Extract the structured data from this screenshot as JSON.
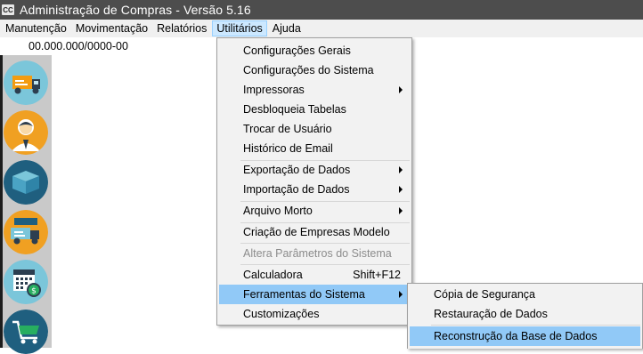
{
  "window": {
    "icon_text": "CC",
    "title": "Administração de Compras - Versão 5.16"
  },
  "menubar": {
    "items": [
      {
        "label": "Manutenção"
      },
      {
        "label": "Movimentação"
      },
      {
        "label": "Relatórios"
      },
      {
        "label": "Utilitários"
      },
      {
        "label": "Ajuda"
      }
    ]
  },
  "cnpj": "00.000.000/0000-00",
  "sidebar": {
    "buttons": [
      {
        "icon": "delivery-truck-icon",
        "color": "#7bc6da"
      },
      {
        "icon": "person-icon",
        "color": "#f0a022"
      },
      {
        "icon": "box-icon",
        "color": "#1f5f7f"
      },
      {
        "icon": "truck-transfer-icon",
        "color": "#f0a022"
      },
      {
        "icon": "calendar-money-icon",
        "color": "#7bc6da"
      },
      {
        "icon": "cart-icon",
        "color": "#1f5f7f"
      }
    ]
  },
  "utilitarios_menu": {
    "items": [
      {
        "label": "Configurações Gerais"
      },
      {
        "label": "Configurações do Sistema"
      },
      {
        "label": "Impressoras"
      },
      {
        "label": "Desbloqueia Tabelas"
      },
      {
        "label": "Trocar de Usuário"
      },
      {
        "label": "Histórico de Email"
      },
      {
        "label": "Exportação de Dados"
      },
      {
        "label": "Importação de Dados"
      },
      {
        "label": "Arquivo Morto"
      },
      {
        "label": "Criação de Empresas Modelo"
      },
      {
        "label": "Altera Parâmetros do Sistema"
      },
      {
        "label": "Calculadora",
        "shortcut": "Shift+F12"
      },
      {
        "label": "Ferramentas do Sistema"
      },
      {
        "label": "Customizações"
      }
    ]
  },
  "ferramentas_submenu": {
    "items": [
      {
        "label": "Cópia de Segurança"
      },
      {
        "label": "Restauração de Dados"
      },
      {
        "label": "Reconstrução da Base de Dados"
      }
    ]
  }
}
